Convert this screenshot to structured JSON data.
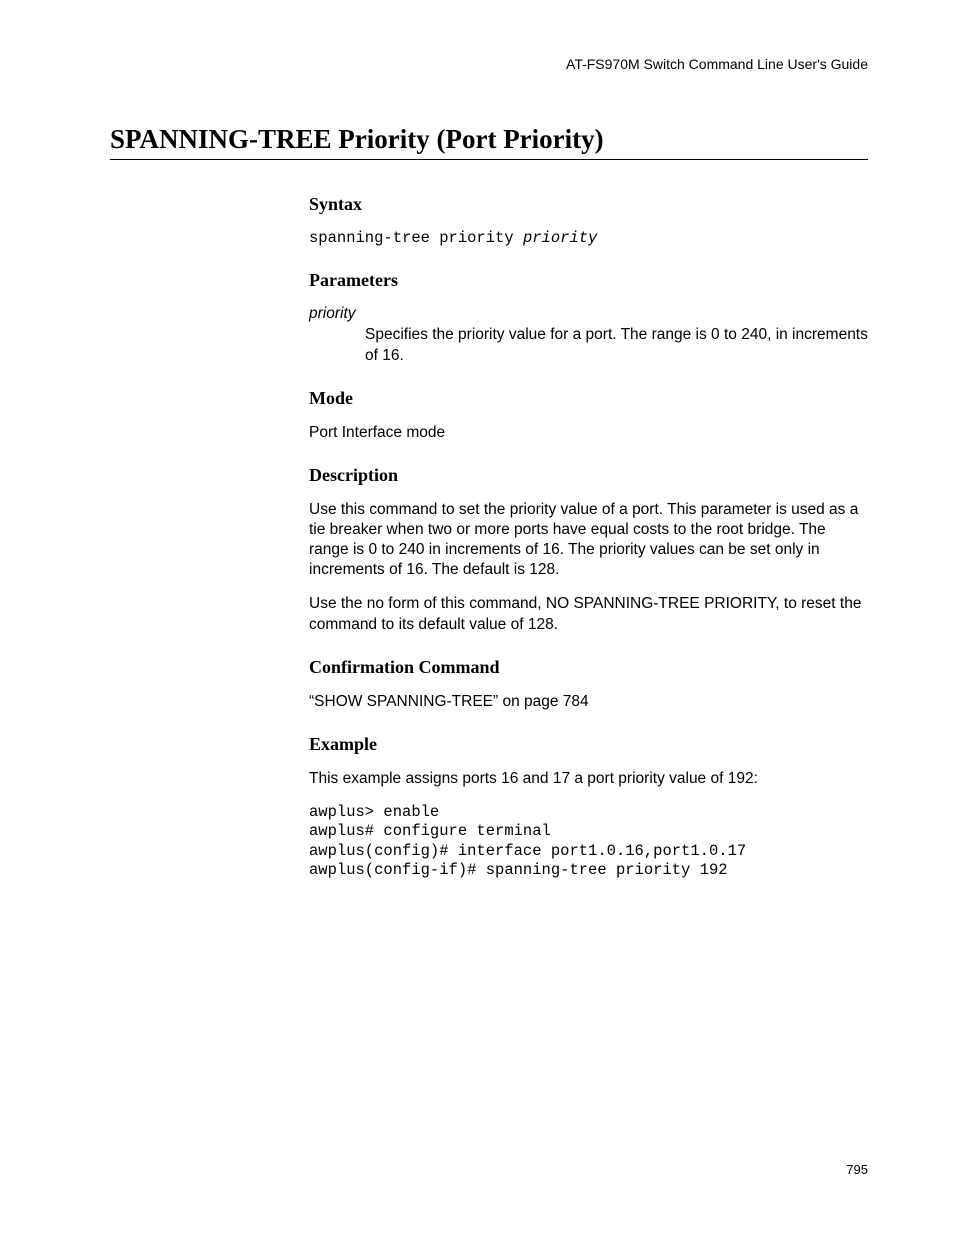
{
  "header": {
    "running": "AT-FS970M Switch Command Line User's Guide"
  },
  "title": "SPANNING-TREE Priority (Port Priority)",
  "syntax": {
    "heading": "Syntax",
    "cmd_prefix": "spanning-tree priority ",
    "cmd_arg": "priority"
  },
  "parameters": {
    "heading": "Parameters",
    "term": "priority",
    "desc": "Specifies the priority value for a port. The range is 0 to 240, in increments of 16."
  },
  "mode": {
    "heading": "Mode",
    "text": "Port Interface mode"
  },
  "description": {
    "heading": "Description",
    "p1": "Use this command to set the priority value of a port. This parameter is used as a tie breaker when two or more ports have equal costs to the root bridge. The range is 0 to 240 in increments of 16. The priority values can be set only in increments of 16. The default is 128.",
    "p2": "Use the no form of this command, NO SPANNING-TREE PRIORITY, to reset the command to its default value of 128."
  },
  "confirmation": {
    "heading": "Confirmation Command",
    "text": "“SHOW SPANNING-TREE” on page 784"
  },
  "example": {
    "heading": "Example",
    "intro": "This example assigns ports 16 and 17 a port priority value of 192:",
    "code": "awplus> enable\nawplus# configure terminal\nawplus(config)# interface port1.0.16,port1.0.17\nawplus(config-if)# spanning-tree priority 192"
  },
  "page_number": "795"
}
